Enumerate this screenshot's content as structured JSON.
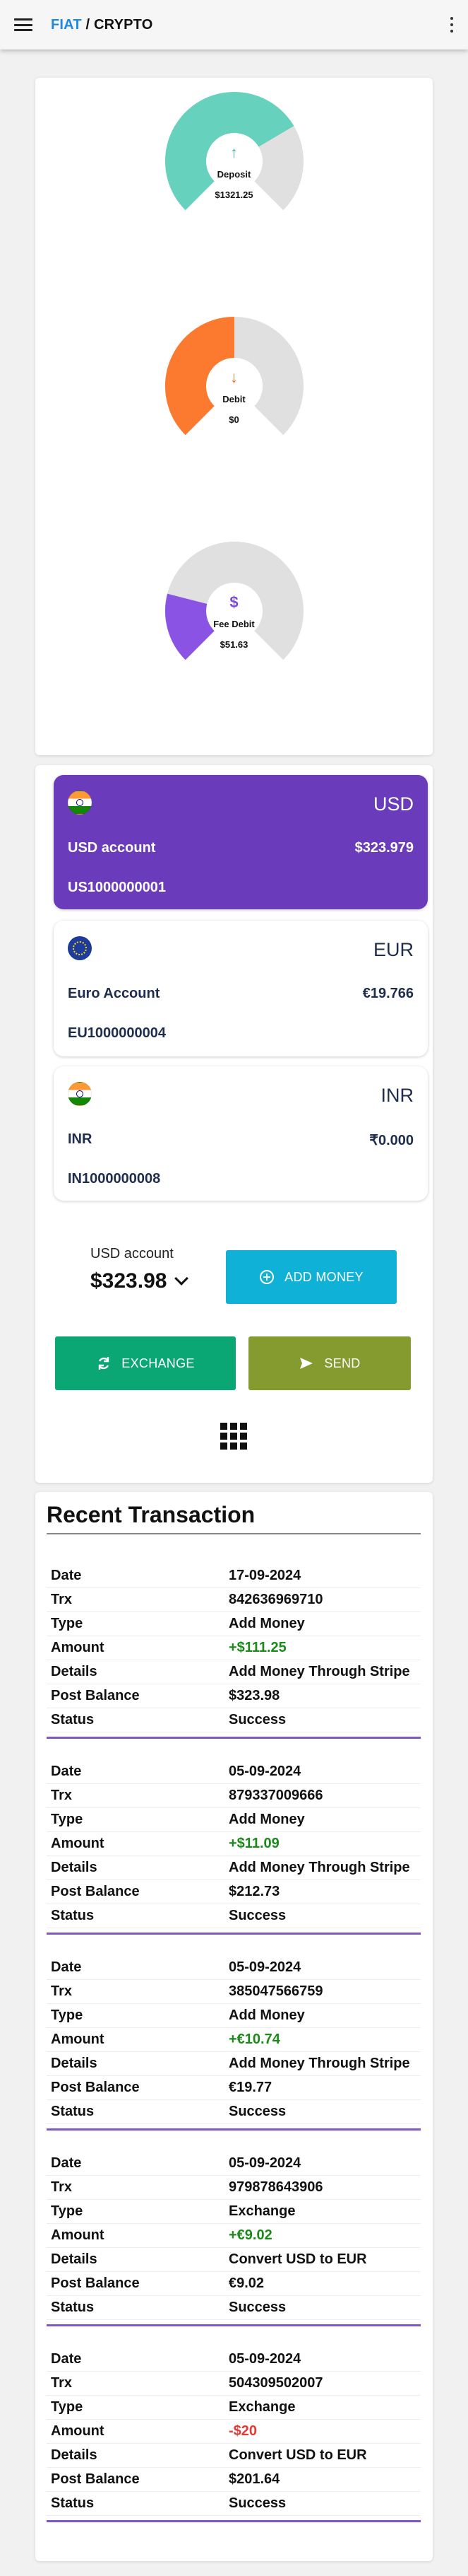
{
  "appbar": {
    "brand_fiat": "FIAT",
    "brand_sep": " / ",
    "brand_crypto": "CRYPTO"
  },
  "gauges": [
    {
      "icon": "↑",
      "icon_name": "arrow-up-icon",
      "label": "Deposit",
      "value": "$1321.25",
      "fill_fraction": 0.72,
      "color": "#66d1bd",
      "icon_color": "#3fb89c"
    },
    {
      "icon": "↓",
      "icon_name": "arrow-down-icon",
      "label": "Debit",
      "value": "$0",
      "fill_fraction": 0.5,
      "color": "#fb7a2f",
      "icon_color": "#f26b22"
    },
    {
      "icon": "$",
      "icon_name": "dollar-icon",
      "label": "Fee Debit",
      "value": "$51.63",
      "fill_fraction": 0.22,
      "color": "#8a53e3",
      "icon_color": "#7c4ad8"
    }
  ],
  "gauge_track_color": "#e0e0e0",
  "accounts": [
    {
      "currency": "USD",
      "name": "USD account",
      "balance": "$323.979",
      "number": "US1000000001",
      "flag": "india",
      "active": true
    },
    {
      "currency": "EUR",
      "name": "Euro Account",
      "balance": "€19.766",
      "number": "EU1000000004",
      "flag": "eu",
      "active": false
    },
    {
      "currency": "INR",
      "name": "INR",
      "balance": "₹0.000",
      "number": "IN1000000008",
      "flag": "india",
      "active": false
    }
  ],
  "selected_account": {
    "label": "USD account",
    "amount": "$323.98"
  },
  "actions": {
    "add_money": "ADD MONEY",
    "exchange": "EXCHANGE",
    "send": "SEND"
  },
  "recent": {
    "title": "Recent Transaction",
    "field_labels": {
      "date": "Date",
      "trx": "Trx",
      "type": "Type",
      "amount": "Amount",
      "details": "Details",
      "post_balance": "Post Balance",
      "status": "Status"
    },
    "transactions": [
      {
        "date": "17-09-2024",
        "trx": "842636969710",
        "type": "Add Money",
        "amount": "+$111.25",
        "amount_sign": "pos",
        "details": "Add Money Through Stripe",
        "post_balance": "$323.98",
        "status": "Success"
      },
      {
        "date": "05-09-2024",
        "trx": "879337009666",
        "type": "Add Money",
        "amount": "+$11.09",
        "amount_sign": "pos",
        "details": "Add Money Through Stripe",
        "post_balance": "$212.73",
        "status": "Success"
      },
      {
        "date": "05-09-2024",
        "trx": "385047566759",
        "type": "Add Money",
        "amount": "+€10.74",
        "amount_sign": "pos",
        "details": "Add Money Through Stripe",
        "post_balance": "€19.77",
        "status": "Success"
      },
      {
        "date": "05-09-2024",
        "trx": "979878643906",
        "type": "Exchange",
        "amount": "+€9.02",
        "amount_sign": "pos",
        "details": "Convert USD to EUR",
        "post_balance": "€9.02",
        "status": "Success"
      },
      {
        "date": "05-09-2024",
        "trx": "504309502007",
        "type": "Exchange",
        "amount": "-$20",
        "amount_sign": "neg",
        "details": "Convert USD to EUR",
        "post_balance": "$201.64",
        "status": "Success"
      }
    ]
  }
}
